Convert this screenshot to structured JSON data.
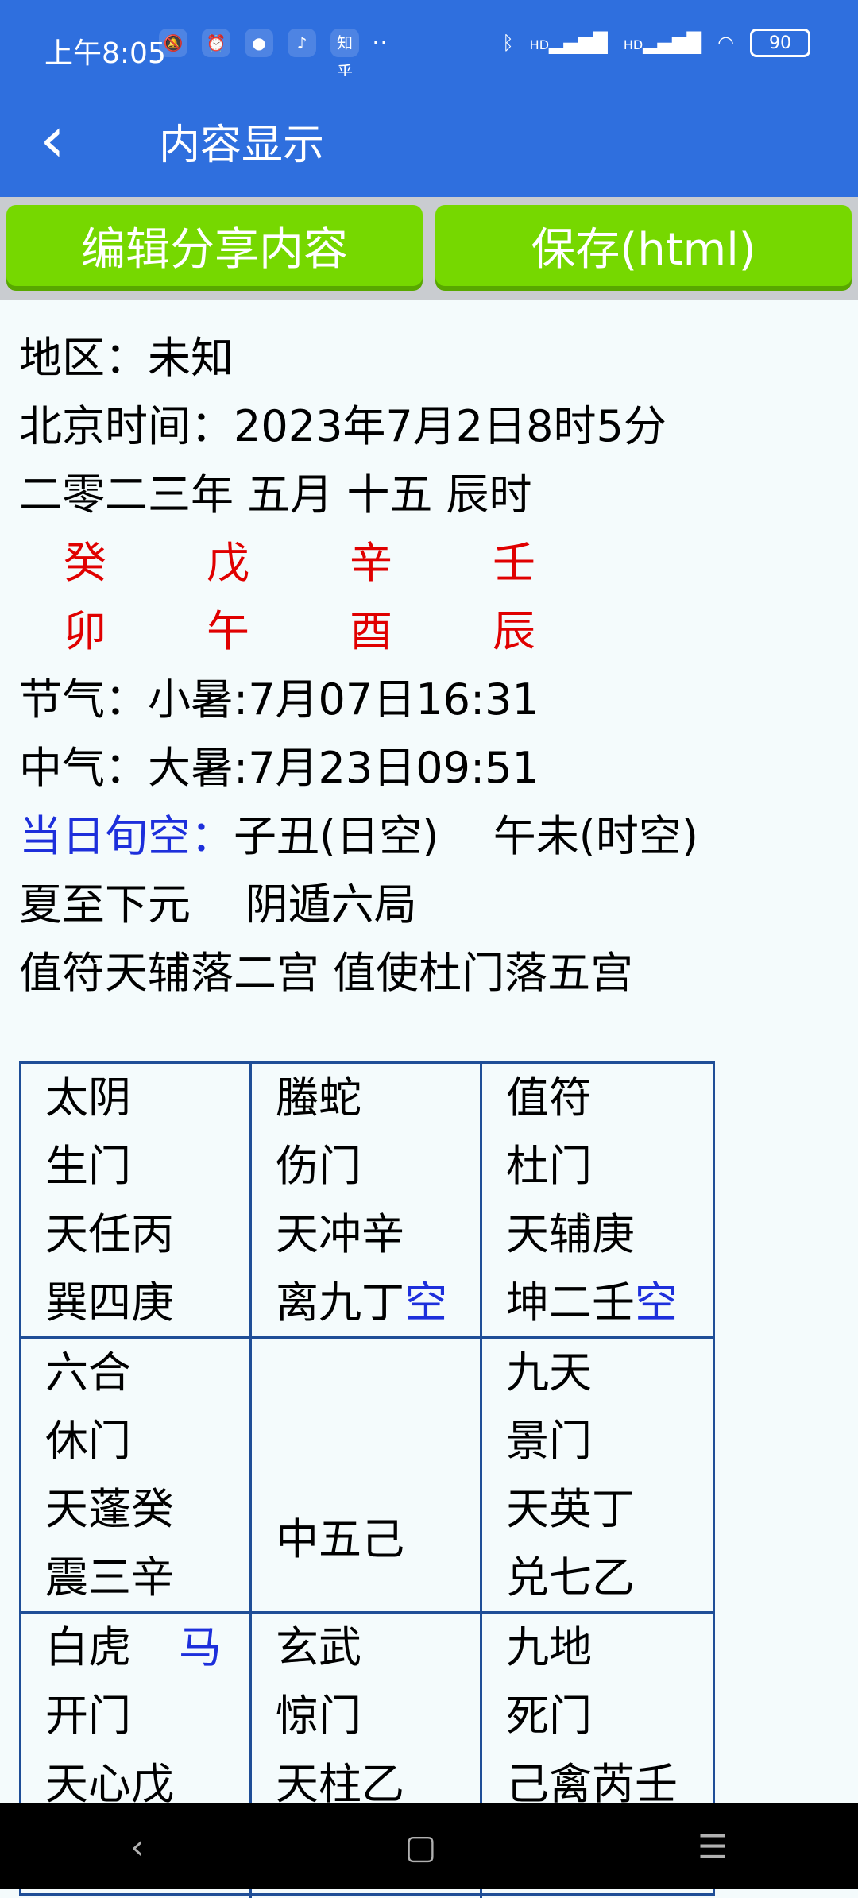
{
  "status_bar": {
    "time": "上午8:05",
    "left_icons": [
      "bell-off-icon",
      "alarm-icon",
      "app-icon",
      "tiktok-icon",
      "zhihu-icon"
    ],
    "zhihu_text": "知乎",
    "more": "··",
    "network1": "HD",
    "network2": "HD",
    "battery": "90"
  },
  "header": {
    "title": "内容显示"
  },
  "buttons": {
    "edit": "编辑分享内容",
    "save": "保存(html)"
  },
  "content": {
    "lines": [
      "地区：未知",
      "北京时间：2023年7月2日8时5分",
      "二零二三年 五月 十五 辰时"
    ],
    "stems": [
      "癸",
      "戊",
      "辛",
      "壬"
    ],
    "branches": [
      "卯",
      "午",
      "酉",
      "辰"
    ],
    "jieqi": "节气：小暑:7月07日16:31",
    "zhongqi": "中气：大暑:7月23日09:51",
    "xunkong_label": "当日旬空：",
    "xunkong_value": "子丑(日空)    午未(时空)",
    "yuan": "夏至下元    阴遁六局",
    "zhifu": "值符天辅落二宫 值使杜门落五宫"
  },
  "grid": {
    "cells": [
      {
        "lines": [
          [
            "太阴",
            "red"
          ],
          [
            "生门",
            "red"
          ],
          [
            "天任丙",
            "red"
          ],
          [
            "巽四庚",
            "black"
          ]
        ]
      },
      {
        "lines": [
          [
            "螣蛇",
            "black"
          ],
          [
            "伤门",
            "black"
          ],
          [
            "天冲辛",
            "red"
          ],
          [
            "离九丁",
            "black"
          ]
        ],
        "kong": "空"
      },
      {
        "lines": [
          [
            "值符",
            "red"
          ],
          [
            "杜门",
            "black"
          ],
          [
            "天辅庚",
            "red"
          ],
          [
            "坤二壬",
            "black"
          ]
        ],
        "kong": "空"
      },
      {
        "lines": [
          [
            "六合",
            "red"
          ],
          [
            "休门",
            "red"
          ],
          [
            "天蓬癸",
            "black"
          ],
          [
            "震三辛",
            "black"
          ]
        ]
      },
      {
        "lines": [
          [
            "中五己",
            "black"
          ]
        ]
      },
      {
        "lines": [
          [
            "九天",
            "red"
          ],
          [
            "景门",
            "black"
          ],
          [
            "天英丁",
            "black"
          ],
          [
            "兑七乙",
            "black"
          ]
        ]
      },
      {
        "lines": [
          [
            "白虎",
            "black"
          ],
          [
            "开门",
            "red"
          ],
          [
            "天心戊",
            "red"
          ]
        ],
        "ma": "马"
      },
      {
        "lines": [
          [
            "玄武",
            "black"
          ],
          [
            "惊门",
            "black"
          ],
          [
            "天柱乙",
            "black"
          ]
        ]
      },
      {
        "lines": [
          [
            "九地",
            "red"
          ],
          [
            "死门",
            "black"
          ],
          [
            "己禽芮壬",
            "black"
          ]
        ]
      }
    ]
  },
  "nav": {
    "back": "‹",
    "home": "▢",
    "menu": "☰"
  }
}
